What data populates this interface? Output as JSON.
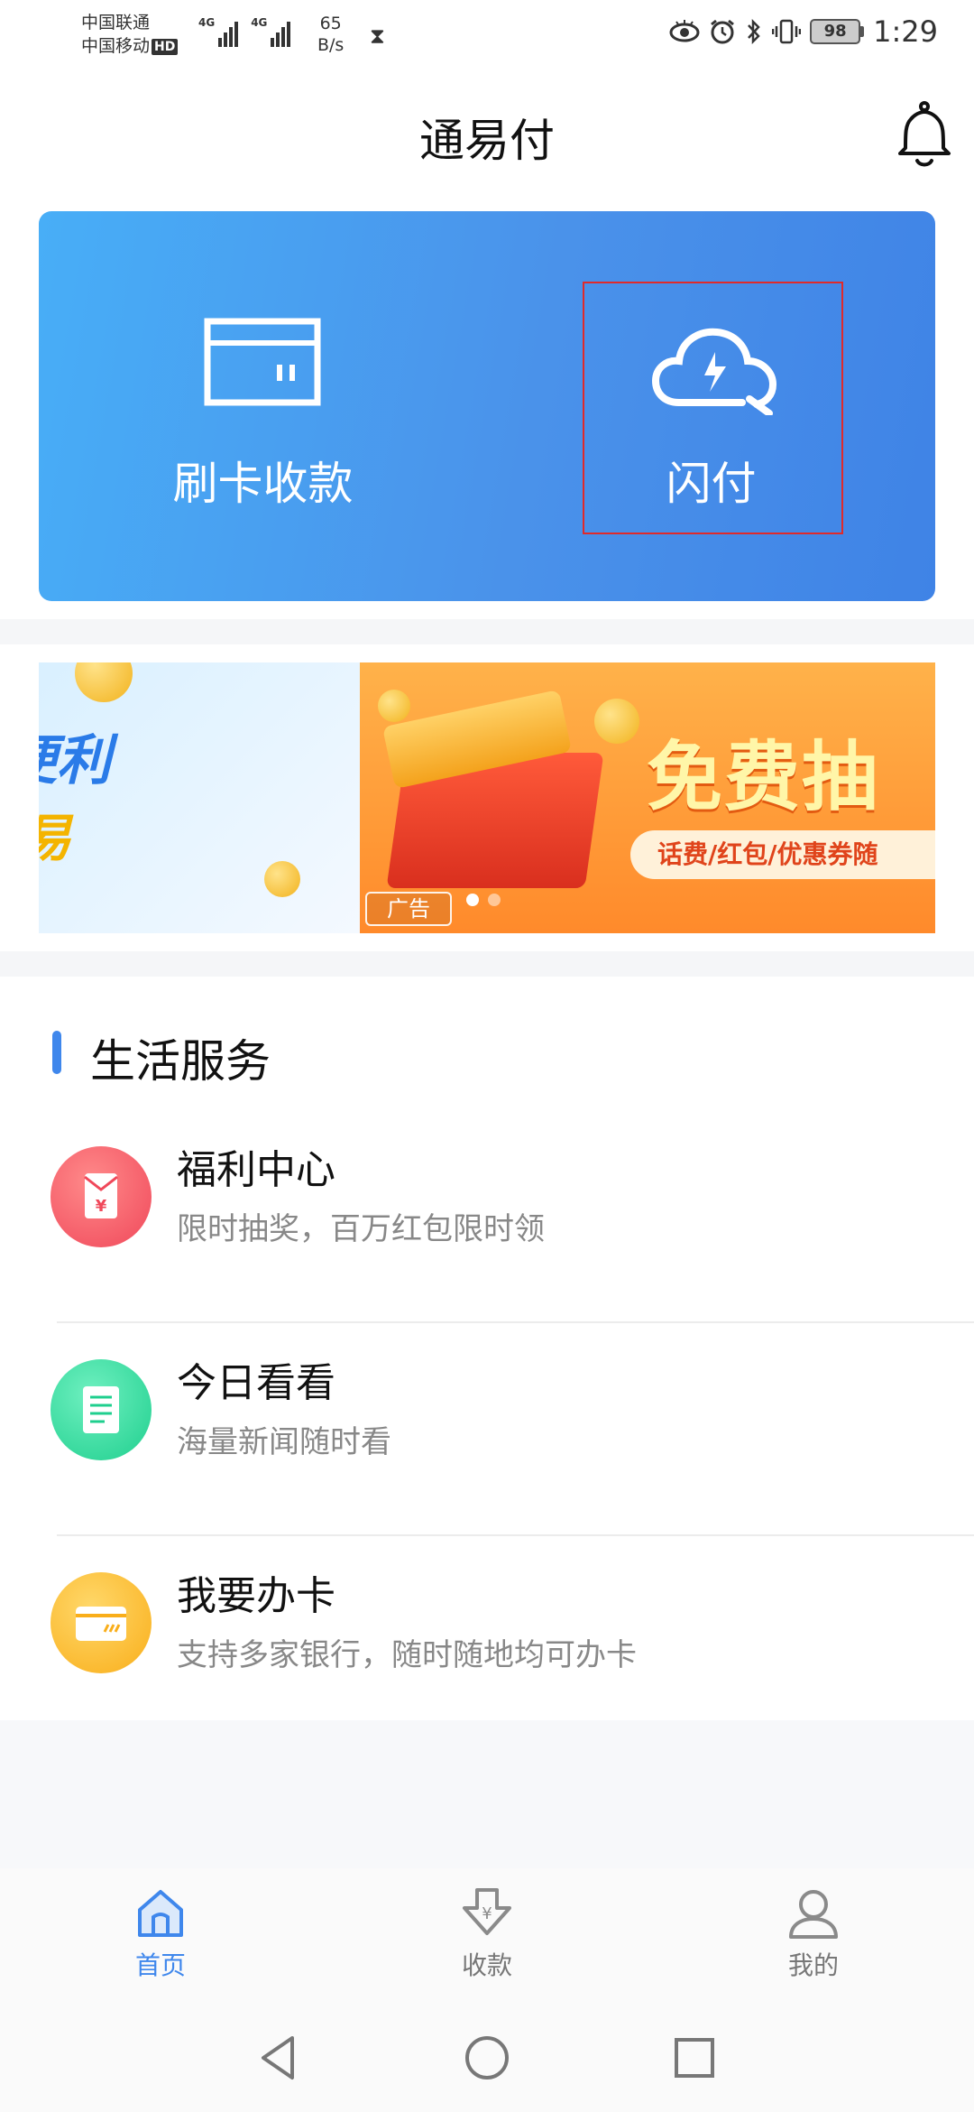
{
  "status_bar": {
    "carrier_1": "中国联通",
    "carrier_2": "中国移动",
    "hd": "HD",
    "network_1": "4G",
    "network_2": "4G",
    "speed_value": "65",
    "speed_unit": "B/s",
    "battery": "98",
    "time": "1:29"
  },
  "header": {
    "title": "通易付"
  },
  "hero": {
    "left_label": "刷卡收款",
    "right_label": "闪付",
    "accent_color": "#4a92ea",
    "highlight_color": "#e02a2a"
  },
  "banner": {
    "left_text_1": "便利",
    "left_text_2": "易",
    "headline": "免费抽",
    "subline": "话费/红包/优惠券随",
    "ad_tag": "广告",
    "slide_count": 2,
    "active_slide": 0
  },
  "services": {
    "title": "生活服务",
    "items": [
      {
        "name": "福利中心",
        "desc": "限时抽奖，百万红包限时领",
        "icon": "red-envelope-icon",
        "color": "#f45a6a"
      },
      {
        "name": "今日看看",
        "desc": "海量新闻随时看",
        "icon": "news-icon",
        "color": "#2fd49a"
      },
      {
        "name": "我要办卡",
        "desc": "支持多家银行，随时随地均可办卡",
        "icon": "bank-card-icon",
        "color": "#fbb828"
      }
    ]
  },
  "bottom_nav": {
    "items": [
      {
        "label": "首页",
        "icon": "home-icon",
        "active": true
      },
      {
        "label": "收款",
        "icon": "receive-payment-icon",
        "active": false
      },
      {
        "label": "我的",
        "icon": "profile-icon",
        "active": false
      }
    ],
    "active_color": "#3f87ec"
  }
}
